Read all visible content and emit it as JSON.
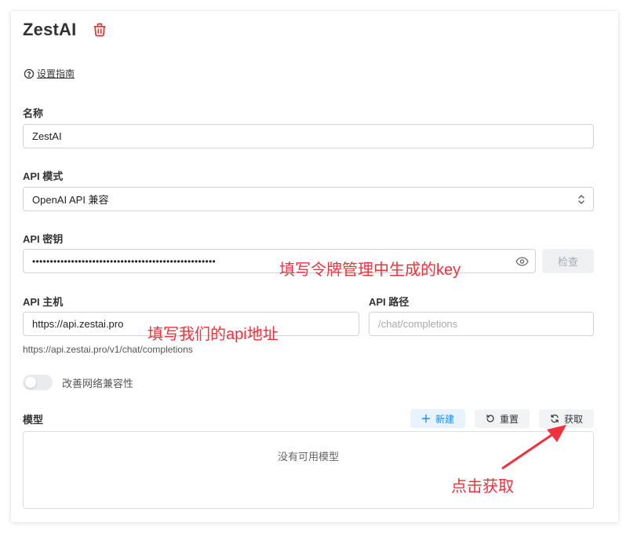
{
  "header": {
    "title": "ZestAI",
    "delete_icon": "trash-icon"
  },
  "guide": {
    "label": "设置指南",
    "icon": "help-circle-icon"
  },
  "name_field": {
    "label": "名称",
    "value": "ZestAI"
  },
  "api_mode": {
    "label": "API 模式",
    "value": "OpenAI API 兼容"
  },
  "api_key": {
    "label": "API 密钥",
    "value": "••••••••••••••••••••••••••••••••••••••••••••••••••••",
    "check_label": "检查"
  },
  "api_host": {
    "label": "API 主机",
    "value": "https://api.zestai.pro"
  },
  "api_path": {
    "label": "API 路径",
    "placeholder": "/chat/completions"
  },
  "endpoint_hint": "https://api.zestai.pro/v1/chat/completions",
  "network_toggle": {
    "label": "改善网络兼容性",
    "enabled": false
  },
  "models": {
    "label": "模型",
    "new_label": "新建",
    "reset_label": "重置",
    "fetch_label": "获取",
    "empty_text": "没有可用模型"
  },
  "annotations": {
    "key_note": "填写令牌管理中生成的key",
    "host_note": "填写我们的api地址",
    "fetch_note": "点击获取"
  },
  "colors": {
    "accent": "#228be6",
    "danger": "#e03131",
    "annotation": "#f0323c"
  }
}
